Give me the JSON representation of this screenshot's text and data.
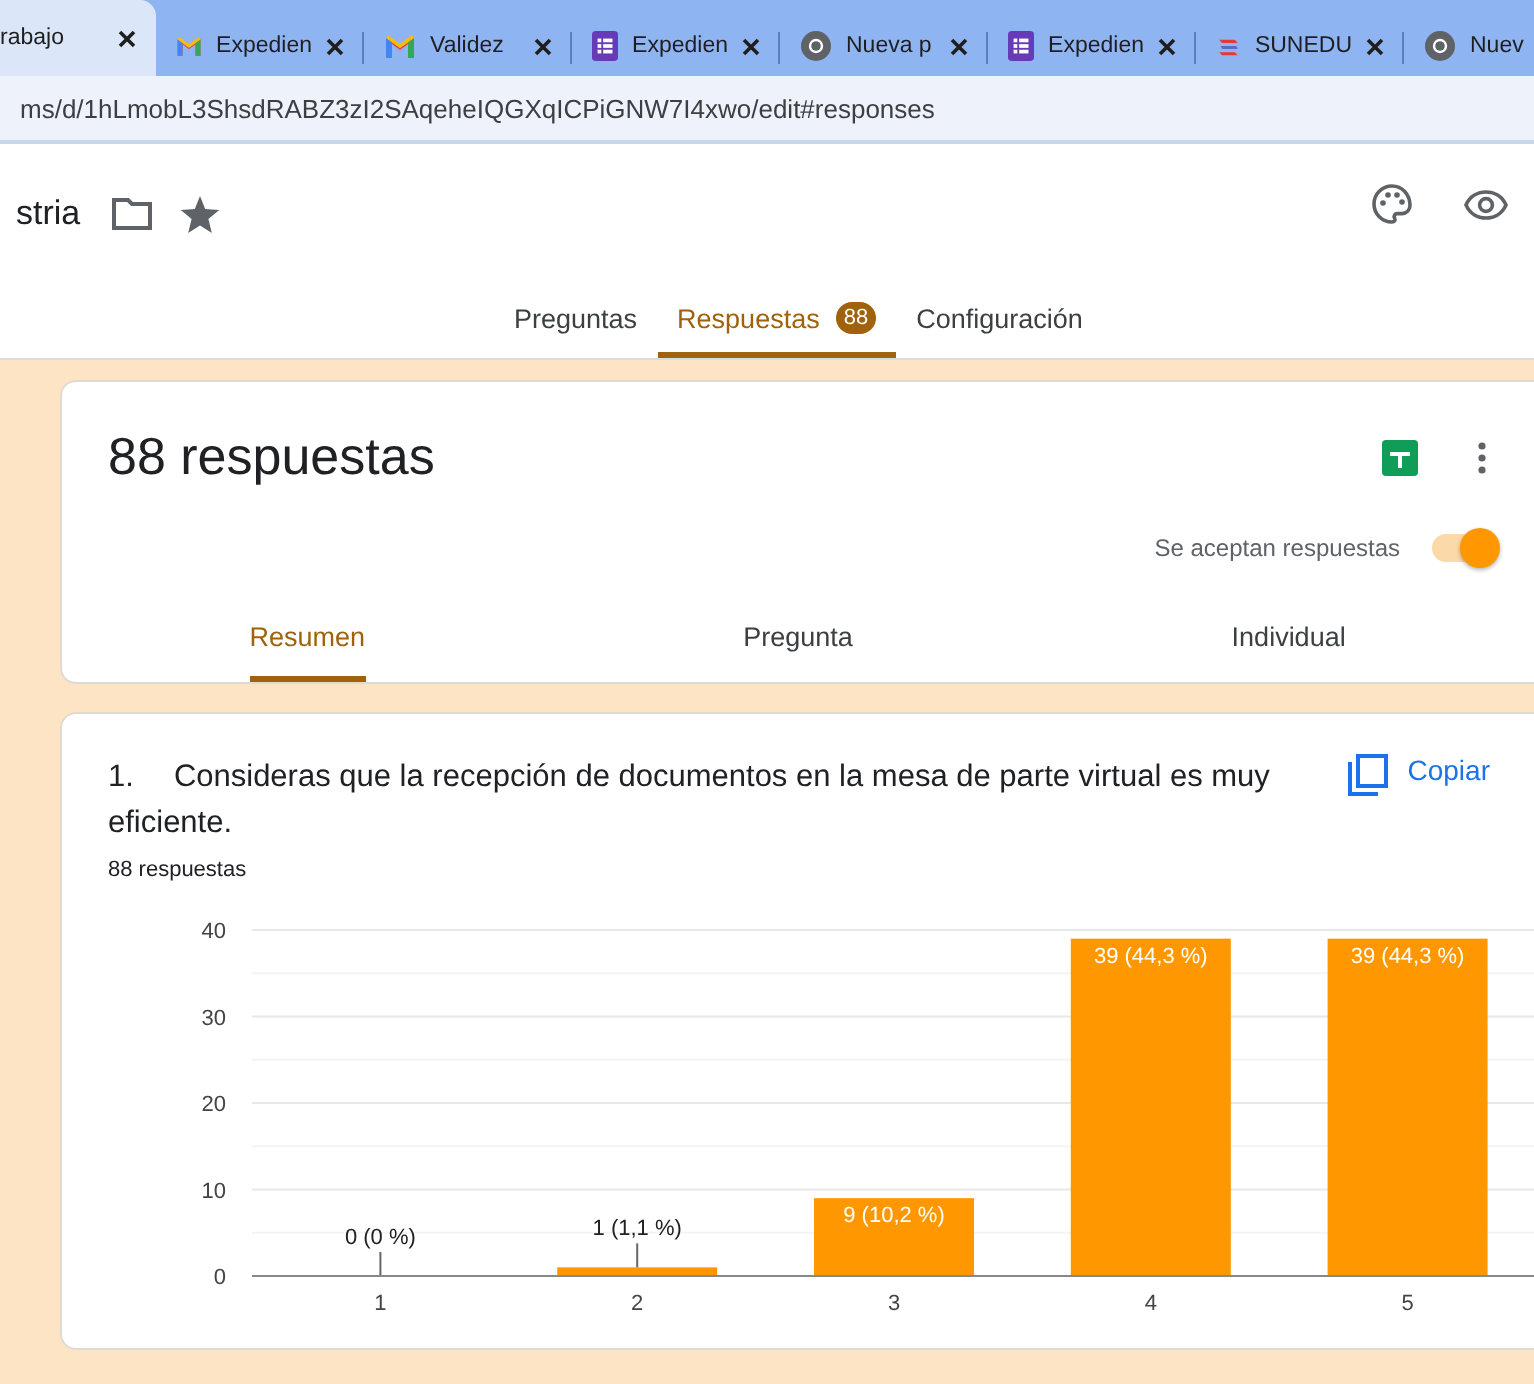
{
  "browser": {
    "tabs": [
      {
        "title": "rabajo",
        "selected": true,
        "closable": true
      },
      {
        "title": "Expedien",
        "kind": "gmail",
        "selected": false,
        "closable": true
      },
      {
        "title": "Validez",
        "kind": "gmail",
        "selected": false,
        "closable": true
      },
      {
        "title": "Expedien",
        "kind": "forms",
        "selected": false,
        "closable": true
      },
      {
        "title": "Nueva p",
        "kind": "chrome",
        "selected": false,
        "closable": true
      },
      {
        "title": "Expedien",
        "kind": "forms",
        "selected": false,
        "closable": true
      },
      {
        "title": "SUNEDU",
        "kind": "sunedu",
        "selected": false,
        "closable": true
      },
      {
        "title": "Nuev",
        "kind": "chrome",
        "selected": false,
        "closable": false
      }
    ],
    "address": "ms/d/1hLmobL3ShsdRABZ3zI2SAqeheIQGXqICPiGNW7I4xwo/edit#responses"
  },
  "header": {
    "title": "stria"
  },
  "nav_tabs": [
    {
      "label": "Preguntas",
      "selected": false
    },
    {
      "label": "Respuestas",
      "badge": "88",
      "selected": true
    },
    {
      "label": "Configuración",
      "selected": false
    }
  ],
  "summary_card": {
    "title": "88 respuestas",
    "accepting_label": "Se aceptan respuestas",
    "accepting": true,
    "tabs": [
      {
        "label": "Resumen",
        "selected": true
      },
      {
        "label": "Pregunta",
        "selected": false
      },
      {
        "label": "Individual",
        "selected": false
      }
    ]
  },
  "question": {
    "number": "1.",
    "text": "Consideras que la recepción de documentos en la mesa de parte virtual es muy eficiente.",
    "copy_label": "Copiar",
    "response_count": "88 respuestas",
    "chart_data": {
      "type": "bar",
      "categories": [
        "1",
        "2",
        "3",
        "4",
        "5"
      ],
      "series": [
        {
          "color": "#ff9800",
          "values": [
            0,
            1,
            9,
            39,
            39
          ]
        }
      ],
      "ylim": [
        0,
        40
      ],
      "yticks": [
        0,
        10,
        20,
        30,
        40
      ],
      "grid": true,
      "value_labels": [
        "0 (0 %)",
        "1 (1,1 %)",
        "9 (10,2 %)",
        "39 (44,3 %)",
        "39 (44,3 %)"
      ]
    }
  }
}
